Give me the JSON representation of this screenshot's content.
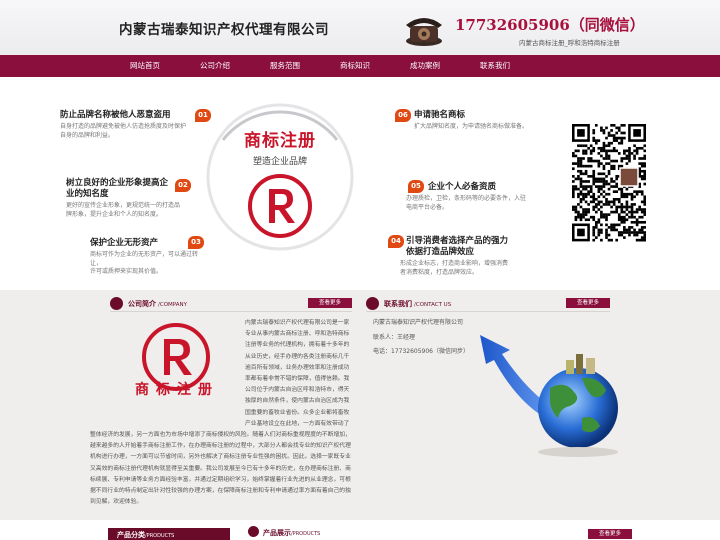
{
  "header": {
    "company_name": "内蒙古瑞泰知识产权代理有限公司",
    "phone": "17732605906（同微信）",
    "subline": "内蒙古商标注册_呼和浩特商标注册"
  },
  "nav": [
    "网站首页",
    "公司介绍",
    "服务范围",
    "商标知识",
    "成功案例",
    "联系我们"
  ],
  "hero": {
    "title": "商标注册",
    "subtitle": "塑造企业品牌",
    "features": [
      {
        "num": "01",
        "title": "防止品牌名称被他人恶意盗用",
        "desc": [
          "自身打造的品牌避免被他人仿造抢质度及时保护",
          "自身的品牌和利益。"
        ]
      },
      {
        "num": "02",
        "title": "树立良好的企业形象提高企",
        "title2": "业的知名度",
        "desc": [
          "更好的宣传企业形象，更规范统一的打造品",
          "牌形象，提升企业和个人的知名度。"
        ]
      },
      {
        "num": "03",
        "title": "保护企业无形资产",
        "desc": [
          "商标可作为企业的无形资产，可以通过转让，",
          "许可或质押来实现其价值。"
        ]
      },
      {
        "num": "06",
        "title": "申请驰名商标",
        "desc": [
          "扩大品牌知名度，为申请驰名商标做准备。"
        ]
      },
      {
        "num": "05",
        "title": "企业个人必备资质",
        "desc": [
          "办理质检，卫检，条形码等的必要条件，入驻",
          "电商平台必备。"
        ]
      },
      {
        "num": "04",
        "title": "引导消费者选择产品的强力",
        "title2": "依据打造品牌效应",
        "desc": [
          "形成企业标志，打造商业影响，增强消费",
          "者消费粘度，打造品牌效应。"
        ]
      }
    ]
  },
  "about": {
    "title": "公司简介",
    "title_en": "/COMPANY",
    "more": "查看更多",
    "logo_text": "商标注册",
    "text": "内蒙古瑞泰知识产权代理有限公司是一家专业从事内蒙古商标注册、呼和浩特商标注册等业务的代理机构，拥有着十多年的从业历史，经手办理的各类注册商标几千逾百所有领域，业务办理效率和注册成功率都有着非常不错的保障，值得信赖。我公司位于内蒙古自治区呼和浩特市，得天独厚的自然条件，使内蒙古自治区成为我国重要的畜牧业省份。众多企业都将畜牧产业基地设立在此地，一方面有效带动了整体经济的发展，另一方面也为市场中增添了商标侵权的风险。随着人们对商标重视程度的不断增加，越来越多的人开始着手商标注册工作，在办理商标注册的过程中，大部分人都会找专业的知识产权代理机构进行办理，一方面可以节省时间，另外也解决了商标注册专业性强的困扰。因此，选择一家既专业又高效的商标注册代理机构就显得至关重要。我公司发展至今已有十多年的历史，在办理商标注册、商标续展、专利申请等业务方面经验丰富，并通过定期组织学习，始终掌握着行业先进的从业理念，可根据不同行业的特点制定出针对性较强的办理方案，在保障商标注册和专利申请通过率方面有着自己的独到见解，欢迎体验。"
  },
  "contact": {
    "title": "联系我们",
    "title_en": "/CONTACT US",
    "more": "查看更多",
    "company": "内蒙古瑞泰知识产权代理有限公司",
    "person": "联系人：王经理",
    "phone": "电话：17732605906（微信同步）"
  },
  "products": {
    "category_title": "产品分类",
    "category_title_en": "/PRODUCTS",
    "show_title": "产品展示",
    "show_title_en": "/PRODUCTS",
    "more": "查看更多"
  },
  "colors": {
    "brand": "#8a0f3c",
    "accent": "#c9152a",
    "badge": "#e04a12",
    "lower_bg": "#efeeec"
  }
}
